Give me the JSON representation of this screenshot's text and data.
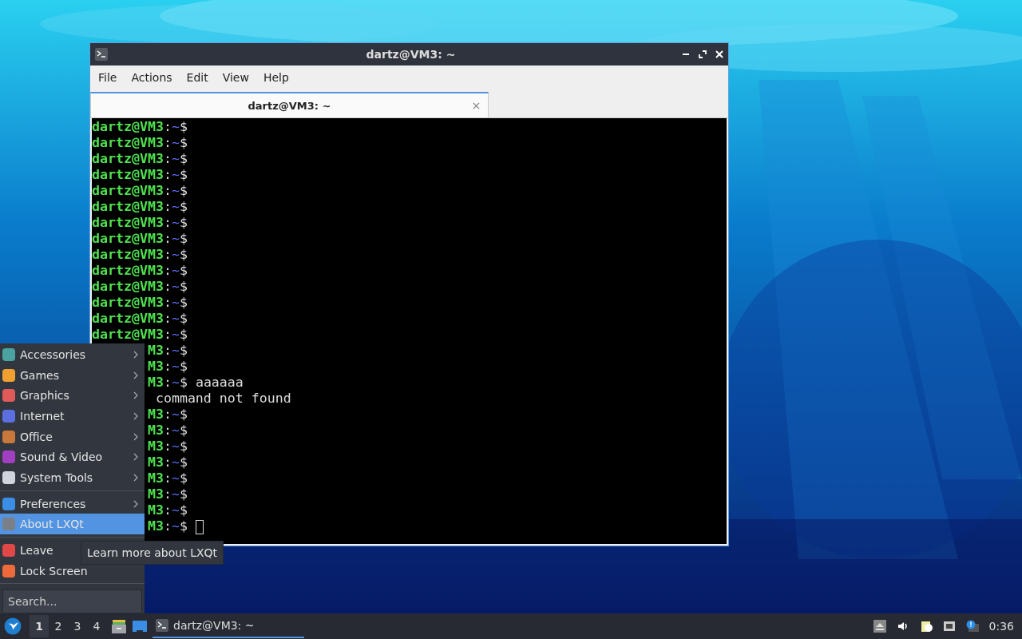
{
  "window": {
    "title": "dartz@VM3: ~",
    "menu_bar": [
      "File",
      "Actions",
      "Edit",
      "View",
      "Help"
    ],
    "tabs": [
      {
        "label": "dartz@VM3: ~",
        "selected": true
      }
    ]
  },
  "terminal": {
    "lines": [
      {
        "kind": "prompt",
        "host": "dartz@VM3",
        "sep": ":",
        "path": "~",
        "symbol": "$"
      },
      {
        "kind": "prompt",
        "host": "dartz@VM3",
        "sep": ":",
        "path": "~",
        "symbol": "$"
      },
      {
        "kind": "prompt",
        "host": "dartz@VM3",
        "sep": ":",
        "path": "~",
        "symbol": "$"
      },
      {
        "kind": "prompt",
        "host": "dartz@VM3",
        "sep": ":",
        "path": "~",
        "symbol": "$"
      },
      {
        "kind": "prompt",
        "host": "dartz@VM3",
        "sep": ":",
        "path": "~",
        "symbol": "$"
      },
      {
        "kind": "prompt",
        "host": "dartz@VM3",
        "sep": ":",
        "path": "~",
        "symbol": "$"
      },
      {
        "kind": "prompt",
        "host": "dartz@VM3",
        "sep": ":",
        "path": "~",
        "symbol": "$"
      },
      {
        "kind": "prompt",
        "host": "dartz@VM3",
        "sep": ":",
        "path": "~",
        "symbol": "$"
      },
      {
        "kind": "prompt",
        "host": "dartz@VM3",
        "sep": ":",
        "path": "~",
        "symbol": "$"
      },
      {
        "kind": "prompt",
        "host": "dartz@VM3",
        "sep": ":",
        "path": "~",
        "symbol": "$"
      },
      {
        "kind": "prompt",
        "host": "dartz@VM3",
        "sep": ":",
        "path": "~",
        "symbol": "$"
      },
      {
        "kind": "prompt",
        "host": "dartz@VM3",
        "sep": ":",
        "path": "~",
        "symbol": "$"
      },
      {
        "kind": "prompt",
        "host": "dartz@VM3",
        "sep": ":",
        "path": "~",
        "symbol": "$"
      },
      {
        "kind": "prompt",
        "host": "dartz@VM3",
        "sep": ":",
        "path": "~",
        "symbol": "$"
      },
      {
        "kind": "prompt-covered",
        "host": "M3",
        "sep": ":",
        "path": "~",
        "symbol": "$"
      },
      {
        "kind": "prompt-covered",
        "host": "M3",
        "sep": ":",
        "path": "~",
        "symbol": "$"
      },
      {
        "kind": "prompt-covered",
        "host": "M3",
        "sep": ":",
        "path": "~",
        "symbol": "$",
        "command": "aaaaaa"
      },
      {
        "kind": "output-covered",
        "text": "command not found"
      },
      {
        "kind": "prompt-covered",
        "host": "M3",
        "sep": ":",
        "path": "~",
        "symbol": "$"
      },
      {
        "kind": "prompt-covered",
        "host": "M3",
        "sep": ":",
        "path": "~",
        "symbol": "$"
      },
      {
        "kind": "prompt-covered",
        "host": "M3",
        "sep": ":",
        "path": "~",
        "symbol": "$"
      },
      {
        "kind": "prompt-covered",
        "host": "M3",
        "sep": ":",
        "path": "~",
        "symbol": "$"
      },
      {
        "kind": "prompt-covered",
        "host": "M3",
        "sep": ":",
        "path": "~",
        "symbol": "$"
      },
      {
        "kind": "prompt-covered",
        "host": "M3",
        "sep": ":",
        "path": "~",
        "symbol": "$"
      },
      {
        "kind": "prompt-covered",
        "host": "M3",
        "sep": ":",
        "path": "~",
        "symbol": "$"
      },
      {
        "kind": "prompt-covered",
        "host": "M3",
        "sep": ":",
        "path": "~",
        "symbol": "$",
        "cursor": true
      }
    ]
  },
  "start_menu": {
    "groups": [
      [
        {
          "label": "Accessories",
          "submenu": true,
          "selected": false
        },
        {
          "label": "Games",
          "submenu": true,
          "selected": false
        },
        {
          "label": "Graphics",
          "submenu": true,
          "selected": false
        },
        {
          "label": "Internet",
          "submenu": true,
          "selected": false
        },
        {
          "label": "Office",
          "submenu": true,
          "selected": false
        },
        {
          "label": "Sound & Video",
          "submenu": true,
          "selected": false
        },
        {
          "label": "System Tools",
          "submenu": true,
          "selected": false
        }
      ],
      [
        {
          "label": "Preferences",
          "submenu": true,
          "selected": false
        },
        {
          "label": "About LXQt",
          "submenu": false,
          "selected": true
        }
      ],
      [
        {
          "label": "Leave",
          "submenu": false,
          "selected": false
        },
        {
          "label": "Lock Screen",
          "submenu": false,
          "selected": false
        }
      ]
    ],
    "search": {
      "placeholder": "Search..."
    }
  },
  "tooltip": "Learn more about LXQt",
  "taskbar": {
    "desktops": [
      {
        "label": "1",
        "selected": true
      },
      {
        "label": "2",
        "selected": false
      },
      {
        "label": "3",
        "selected": false
      },
      {
        "label": "4",
        "selected": false
      }
    ],
    "tasks": [
      {
        "label": "dartz@VM3: ~",
        "selected": true
      }
    ],
    "clock": "0:36"
  }
}
